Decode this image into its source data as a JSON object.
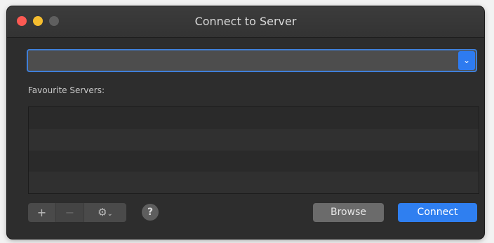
{
  "window": {
    "title": "Connect to Server"
  },
  "server_address": {
    "value": "",
    "dropdown_icon": "chevron-down-icon"
  },
  "favourites": {
    "label": "Favourite Servers:",
    "items": []
  },
  "toolbar": {
    "add_icon": "plus-icon",
    "remove_icon": "minus-icon",
    "action_icon": "gear-icon",
    "help_icon": "question-mark-icon"
  },
  "buttons": {
    "browse_label": "Browse",
    "connect_label": "Connect"
  },
  "colors": {
    "close": "#fc5a53",
    "minimize": "#f5bd2f",
    "zoom": "#5f5f5f",
    "accent": "#2f7ff0"
  }
}
